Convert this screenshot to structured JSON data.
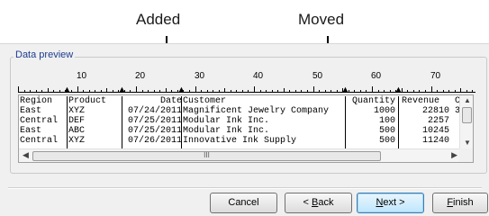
{
  "callouts": {
    "added": "Added",
    "moved": "Moved"
  },
  "group_title": "Data preview",
  "ruler": {
    "labels": [
      "10",
      "20",
      "30",
      "40",
      "50",
      "60",
      "70"
    ]
  },
  "table": {
    "header": [
      "Region",
      "Product",
      "Date",
      "Customer",
      "Quantity",
      "Revenue",
      "C"
    ],
    "rows": [
      [
        "East",
        "XYZ",
        "07/24/2011",
        "Magnificent Jewelry Company",
        "1000",
        "22810",
        "3"
      ],
      [
        "Central",
        "DEF",
        "07/25/2011",
        "Modular Ink Inc.",
        "100",
        "2257",
        ""
      ],
      [
        "East",
        "ABC",
        "07/25/2011",
        "Modular Ink Inc.",
        "500",
        "10245",
        ""
      ],
      [
        "Central",
        "XYZ",
        "07/26/2011",
        "Innovative Ink Supply",
        "500",
        "11240",
        ""
      ]
    ]
  },
  "scroll_grip": "III",
  "buttons": {
    "cancel": "Cancel",
    "back_prefix": "< ",
    "back_key": "B",
    "back_rest": "ack",
    "next_key": "N",
    "next_rest": "ext >",
    "finish_key": "F",
    "finish_rest": "inish"
  }
}
